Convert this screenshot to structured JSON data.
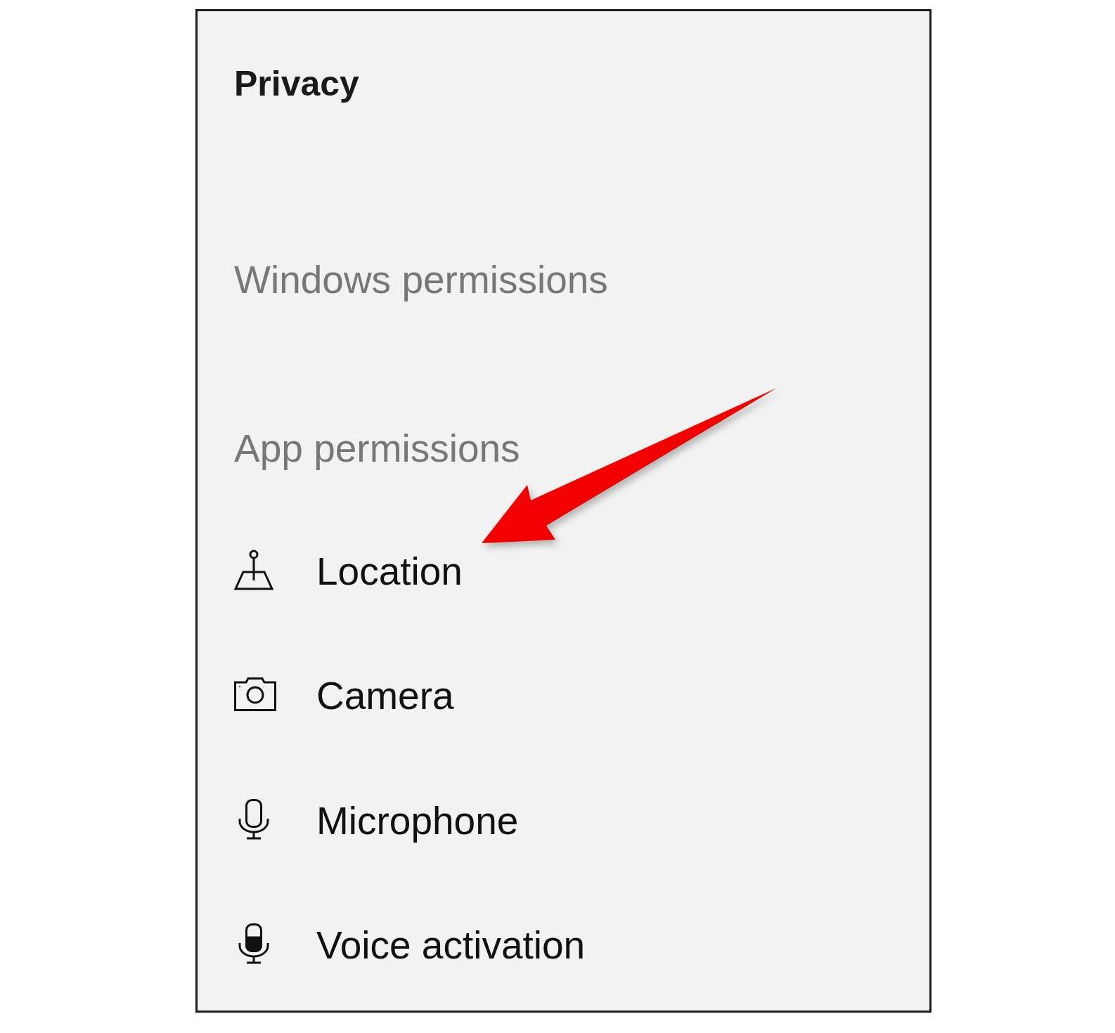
{
  "panel": {
    "title": "Privacy"
  },
  "sections": [
    {
      "heading": "Windows permissions"
    },
    {
      "heading": "App permissions",
      "items": [
        {
          "kind": "location",
          "label": "Location"
        },
        {
          "kind": "camera",
          "label": "Camera"
        },
        {
          "kind": "microphone",
          "label": "Microphone"
        },
        {
          "kind": "voice_activation",
          "label": "Voice activation"
        }
      ]
    }
  ]
}
